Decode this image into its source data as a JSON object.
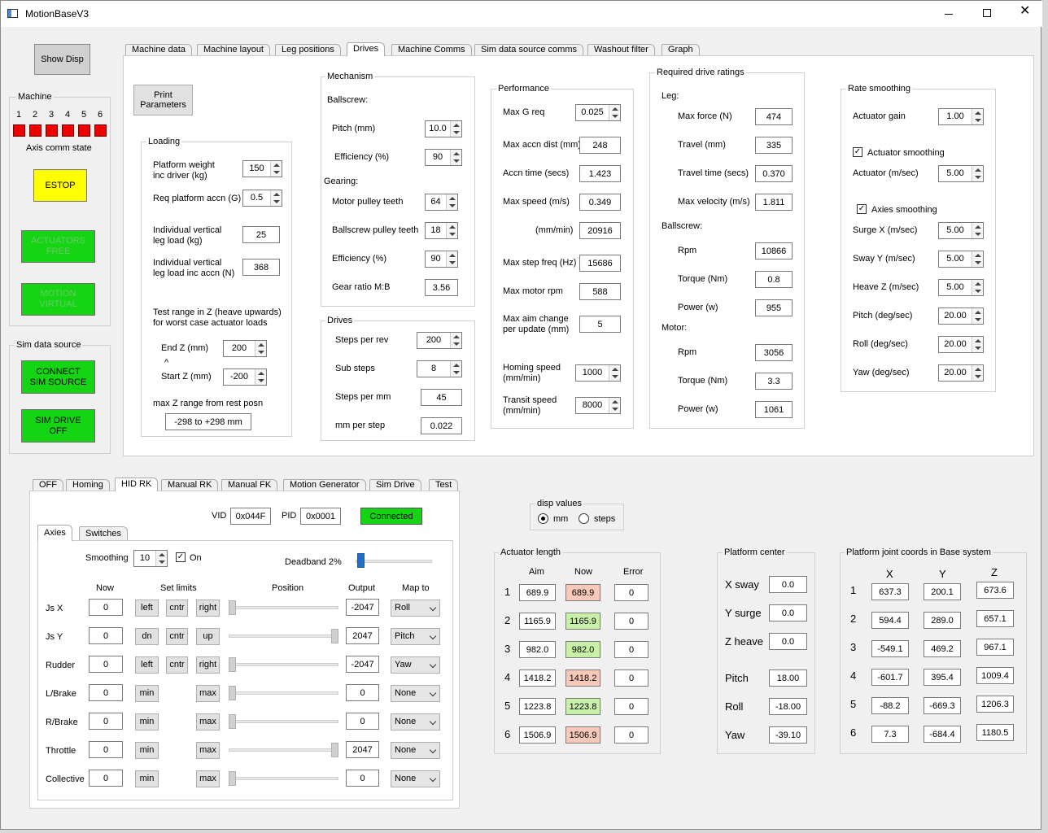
{
  "window": {
    "title": "MotionBaseV3"
  },
  "left": {
    "show_disp": "Show Disp",
    "machine_title": "Machine",
    "axis_numbers": [
      "1",
      "2",
      "3",
      "4",
      "5",
      "6"
    ],
    "axis_comm_label": "Axis comm state",
    "estop": "ESTOP",
    "actuators_btn": "ACTUATORS\nFREE",
    "motion_btn": "MOTION\nVIRTUAL",
    "sim_source_title": "Sim data source",
    "connect_btn": "CONNECT\nSIM SOURCE",
    "sim_drive_btn": "SIM DRIVE\nOFF"
  },
  "top_tabs": [
    "Machine data",
    "Machine layout",
    "Leg positions",
    "Drives",
    "Machine Comms",
    "Sim data source comms",
    "Washout filter",
    "Graph"
  ],
  "print_btn": "Print\nParameters",
  "loading": {
    "title": "Loading",
    "platform_weight_label": "Platform weight\ninc driver (kg)",
    "platform_weight": "150",
    "req_accn_label": "Req platform accn (G)",
    "req_accn": "0.5",
    "ind_load_label": "Individual vertical\nleg load (kg)",
    "ind_load": "25",
    "ind_load_accn_label": "Individual vertical\nleg load inc accn (N)",
    "ind_load_accn": "368",
    "test_range_label": "Test range in Z (heave upwards)\nfor worst case actuator loads",
    "end_z_label": "End Z (mm)",
    "end_z": "200",
    "caret": "^",
    "start_z_label": "Start Z (mm)",
    "start_z": "-200",
    "max_z_label": "max Z range from rest posn",
    "max_z": "-298 to +298 mm"
  },
  "mechanism": {
    "title": "Mechanism",
    "ballscrew_label": "Ballscrew:",
    "pitch_label": "Pitch (mm)",
    "pitch": "10.0",
    "eff_label": "Efficiency (%)",
    "eff": "90",
    "gearing_label": "Gearing:",
    "motor_pulley_label": "Motor pulley teeth",
    "motor_pulley": "64",
    "bs_pulley_label": "Ballscrew pulley teeth",
    "bs_pulley": "18",
    "eff2_label": "Efficiency (%)",
    "eff2": "90",
    "gear_ratio_label": "Gear ratio M:B",
    "gear_ratio": "3.56"
  },
  "drives": {
    "title": "Drives",
    "steps_rev_label": "Steps per rev",
    "steps_rev": "200",
    "sub_steps_label": "Sub steps",
    "sub_steps": "8",
    "steps_mm_label": "Steps per mm",
    "steps_mm": "45",
    "mm_step_label": "mm per step",
    "mm_step": "0.022"
  },
  "performance": {
    "title": "Performance",
    "max_g_label": "Max G req",
    "max_g": "0.025",
    "max_accn_dist_label": "Max accn dist (mm)",
    "max_accn_dist": "248",
    "accn_time_label": "Accn time (secs)",
    "accn_time": "1.423",
    "max_speed_label": "Max speed (m/s)",
    "max_speed": "0.349",
    "mm_min_label": "(mm/min)",
    "mm_min": "20916",
    "max_step_freq_label": "Max step freq (Hz)",
    "max_step_freq": "15686",
    "max_motor_rpm_label": "Max motor rpm",
    "max_motor_rpm": "588",
    "max_aim_label": "Max aim change\nper update (mm)",
    "max_aim": "5",
    "homing_label": "Homing speed\n(mm/min)",
    "homing": "1000",
    "transit_label": "Transit speed\n(mm/min)",
    "transit": "8000"
  },
  "ratings": {
    "title": "Required drive ratings",
    "leg_label": "Leg:",
    "max_force_label": "Max force (N)",
    "max_force": "474",
    "travel_label": "Travel (mm)",
    "travel": "335",
    "travel_time_label": "Travel time (secs)",
    "travel_time": "0.370",
    "max_vel_label": "Max velocity (m/s)",
    "max_vel": "1.811",
    "ballscrew_label": "Ballscrew:",
    "bs_rpm_label": "Rpm",
    "bs_rpm": "10866",
    "bs_torque_label": "Torque (Nm)",
    "bs_torque": "0.8",
    "bs_power_label": "Power (w)",
    "bs_power": "955",
    "motor_label": "Motor:",
    "m_rpm_label": "Rpm",
    "m_rpm": "3056",
    "m_torque_label": "Torque (Nm)",
    "m_torque": "3.3",
    "m_power_label": "Power (w)",
    "m_power": "1061"
  },
  "smoothing": {
    "title": "Rate smoothing",
    "gain_label": "Actuator gain",
    "gain": "1.00",
    "act_smooth_label": "Actuator smoothing",
    "act_label": "Actuator (m/sec)",
    "act": "5.00",
    "axies_smooth_label": "Axies smoothing",
    "surge_label": "Surge X  (m/sec)",
    "surge": "5.00",
    "sway_label": "Sway Y (m/sec)",
    "sway": "5.00",
    "heave_label": "Heave Z  (m/sec)",
    "heave": "5.00",
    "pitch_label": "Pitch (deg/sec)",
    "pitch": "20.00",
    "roll_label": "Roll (deg/sec)",
    "roll": "20.00",
    "yaw_label": "Yaw (deg/sec)",
    "yaw": "20.00"
  },
  "bottom_tabs": [
    "OFF",
    "Homing",
    "HID RK",
    "Manual RK",
    "Manual FK",
    "Motion Generator",
    "Sim Drive",
    "Test"
  ],
  "hid": {
    "vid_label": "VID",
    "vid": "0x044F",
    "pid_label": "PID",
    "pid": "0x0001",
    "connected": "Connected",
    "sub_tabs": [
      "Axies",
      "Switches"
    ],
    "smoothing_label": "Smoothing",
    "smoothing": "10",
    "on_label": "On",
    "deadband_label": "Deadband 2%",
    "deadband_pct": 2,
    "col_now": "Now",
    "col_set": "Set limits",
    "col_pos": "Position",
    "col_out": "Output",
    "col_map": "Map to",
    "rows": [
      {
        "name": "Js X",
        "now": "0",
        "b1": "left",
        "b2": "cntr",
        "b3": "right",
        "pos": 0,
        "out": "-2047",
        "map": "Roll"
      },
      {
        "name": "Js Y",
        "now": "0",
        "b1": "dn",
        "b2": "cntr",
        "b3": "up",
        "pos": 1,
        "out": "2047",
        "map": "Pitch"
      },
      {
        "name": "Rudder",
        "now": "0",
        "b1": "left",
        "b2": "cntr",
        "b3": "right",
        "pos": 0,
        "out": "-2047",
        "map": "Yaw"
      },
      {
        "name": "L/Brake",
        "now": "0",
        "b1": "min",
        "b2": "",
        "b3": "max",
        "pos": 0,
        "out": "0",
        "map": "None"
      },
      {
        "name": "R/Brake",
        "now": "0",
        "b1": "min",
        "b2": "",
        "b3": "max",
        "pos": 0,
        "out": "0",
        "map": "None"
      },
      {
        "name": "Throttle",
        "now": "0",
        "b1": "min",
        "b2": "",
        "b3": "max",
        "pos": 1,
        "out": "2047",
        "map": "None"
      },
      {
        "name": "Collective",
        "now": "0",
        "b1": "min",
        "b2": "",
        "b3": "max",
        "pos": 0,
        "out": "0",
        "map": "None"
      }
    ]
  },
  "disp": {
    "title": "disp values",
    "mm": "mm",
    "steps": "steps"
  },
  "actuator": {
    "title": "Actuator length",
    "col_aim": "Aim",
    "col_now": "Now",
    "col_err": "Error",
    "rows": [
      {
        "n": "1",
        "aim": "689.9",
        "now": "689.9",
        "err": "0",
        "color": "#f8c8b8"
      },
      {
        "n": "2",
        "aim": "1165.9",
        "now": "1165.9",
        "err": "0",
        "color": "#c8f0a8"
      },
      {
        "n": "3",
        "aim": "982.0",
        "now": "982.0",
        "err": "0",
        "color": "#c8f0a8"
      },
      {
        "n": "4",
        "aim": "1418.2",
        "now": "1418.2",
        "err": "0",
        "color": "#f8c8b8"
      },
      {
        "n": "5",
        "aim": "1223.8",
        "now": "1223.8",
        "err": "0",
        "color": "#c8f0a8"
      },
      {
        "n": "6",
        "aim": "1506.9",
        "now": "1506.9",
        "err": "0",
        "color": "#f8c8b8"
      }
    ]
  },
  "center": {
    "title": "Platform center",
    "rows": [
      {
        "label": "X sway",
        "value": "0.0"
      },
      {
        "label": "Y surge",
        "value": "0.0"
      },
      {
        "label": "Z heave",
        "value": "0.0"
      },
      {
        "label": "Pitch",
        "value": "18.00"
      },
      {
        "label": "Roll",
        "value": "-18.00"
      },
      {
        "label": "Yaw",
        "value": "-39.10"
      }
    ]
  },
  "joints": {
    "title": "Platform joint coords in Base system",
    "col_x": "X",
    "col_y": "Y",
    "col_z": "Z",
    "rows": [
      {
        "n": "1",
        "x": "637.3",
        "y": "200.1",
        "z": "673.6"
      },
      {
        "n": "2",
        "x": "594.4",
        "y": "289.0",
        "z": "657.1"
      },
      {
        "n": "3",
        "x": "-549.1",
        "y": "469.2",
        "z": "967.1"
      },
      {
        "n": "4",
        "x": "-601.7",
        "y": "395.4",
        "z": "1009.4"
      },
      {
        "n": "5",
        "x": "-88.2",
        "y": "-669.3",
        "z": "1206.3"
      },
      {
        "n": "6",
        "x": "7.3",
        "y": "-684.4",
        "z": "1180.5"
      }
    ]
  }
}
